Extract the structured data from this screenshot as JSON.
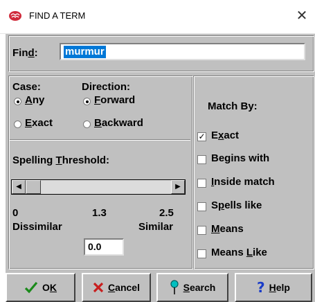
{
  "window": {
    "title": "FIND A TERM",
    "close_glyph": "✕"
  },
  "find": {
    "label_pre": "Fin",
    "label_accel": "d",
    "label_post": ":",
    "value": "murmur"
  },
  "case": {
    "label": "Case:",
    "options": [
      {
        "accel": "A",
        "rest": "ny",
        "selected": true
      },
      {
        "accel": "E",
        "rest": "xact",
        "selected": false
      }
    ]
  },
  "direction": {
    "label": "Direction:",
    "options": [
      {
        "accel": "F",
        "rest": "orward",
        "selected": true
      },
      {
        "accel": "B",
        "rest": "ackward",
        "selected": false
      }
    ]
  },
  "spelling": {
    "label_pre": "Spelling ",
    "label_accel": "T",
    "label_post": "hreshold:",
    "min": "0",
    "mid": "1.3",
    "max": "2.5",
    "left_caption": "Dissimilar",
    "right_caption": "Similar",
    "value": "0.0",
    "slider_fraction": 0.0
  },
  "match_by": {
    "label": "Match By:",
    "options": [
      {
        "pre": "E",
        "accel": "x",
        "post": "act",
        "checked": true
      },
      {
        "pre": "Begins with",
        "accel": "",
        "post": "",
        "checked": false
      },
      {
        "pre": "",
        "accel": "I",
        "post": "nside match",
        "checked": false
      },
      {
        "pre": "S",
        "accel": "p",
        "post": "ells like",
        "checked": false
      },
      {
        "pre": "",
        "accel": "M",
        "post": "eans",
        "checked": false
      },
      {
        "pre": "Means ",
        "accel": "L",
        "post": "ike",
        "checked": false
      }
    ]
  },
  "buttons": {
    "ok": {
      "pre": "O",
      "accel": "K",
      "post": ""
    },
    "cancel": {
      "pre": "",
      "accel": "C",
      "post": "ancel"
    },
    "search": {
      "pre": "",
      "accel": "S",
      "post": "earch"
    },
    "help": {
      "pre": "",
      "accel": "H",
      "post": "elp"
    }
  },
  "colors": {
    "dialog_face": "#c0c0c0",
    "selection": "#0078d7",
    "ok_check": "#1a8a1a",
    "cancel_x": "#c81e1e",
    "search_pin": "#00aaaa",
    "help_question": "#1a3cc8"
  },
  "icons": {
    "app": "brain-icon",
    "ok": "checkmark-icon",
    "cancel": "x-mark-icon",
    "search": "pushpin-icon",
    "help": "question-mark-icon"
  }
}
